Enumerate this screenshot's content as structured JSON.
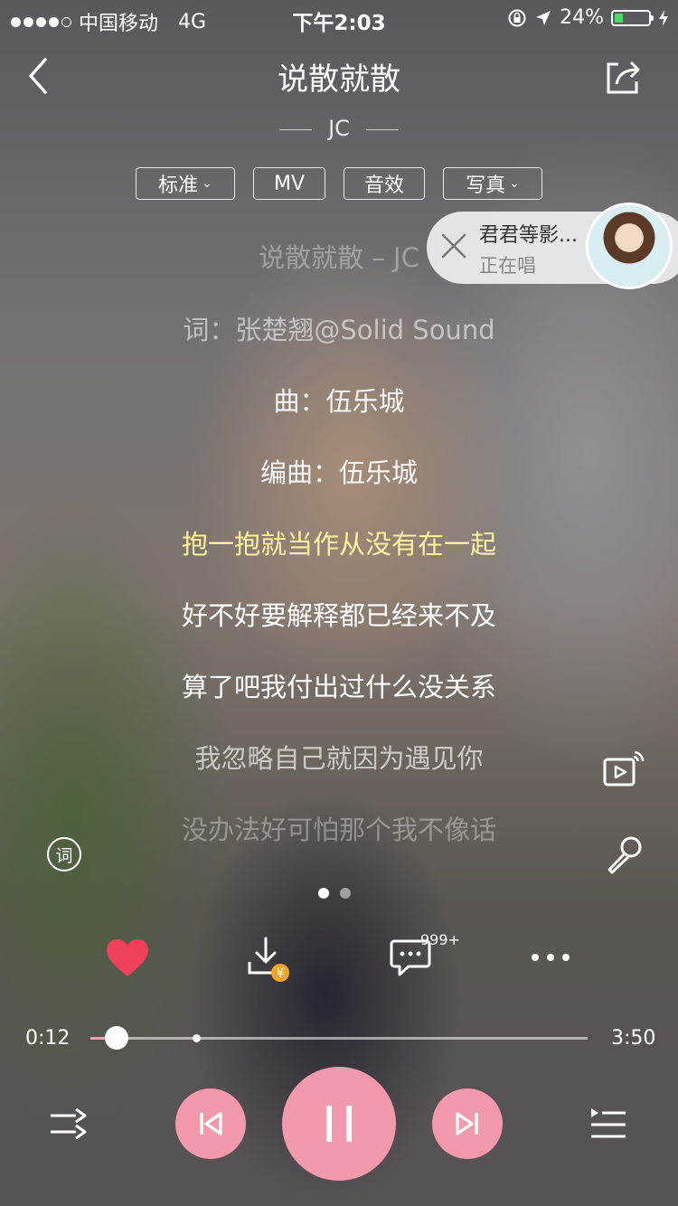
{
  "status": {
    "carrier": "中国移动",
    "network": "4G",
    "time": "下午2:03",
    "battery": "24%",
    "battery_level": 0.24
  },
  "header": {
    "title": "说散就散",
    "artist": "JC"
  },
  "options": [
    {
      "label": "标准",
      "dropdown": true
    },
    {
      "label": "MV",
      "dropdown": false
    },
    {
      "label": "音效",
      "dropdown": false
    },
    {
      "label": "写真",
      "dropdown": true
    }
  ],
  "live_bubble": {
    "name": "君君等影...",
    "status": "正在唱"
  },
  "lyrics": [
    {
      "text": "说散就散 – JC",
      "state": "faded"
    },
    {
      "text": "词：张楚翘@Solid Sound",
      "state": "dim"
    },
    {
      "text": "曲：伍乐城",
      "state": "normal"
    },
    {
      "text": "编曲：伍乐城",
      "state": "normal"
    },
    {
      "text": "抱一抱就当作从没有在一起",
      "state": "active"
    },
    {
      "text": "好不好要解释都已经来不及",
      "state": "normal"
    },
    {
      "text": "算了吧我付出过什么没关系",
      "state": "normal"
    },
    {
      "text": "我忽略自己就因为遇见你",
      "state": "dim"
    },
    {
      "text": "没办法好可怕那个我不像话",
      "state": "faded"
    }
  ],
  "side_icons": {
    "lyrics_icon_label": "词"
  },
  "actions": {
    "comment_count": "999+"
  },
  "player": {
    "elapsed": "0:12",
    "duration": "3:50",
    "progress": 0.052,
    "buffered": 0.205
  },
  "colors": {
    "accent": "#f29aac",
    "active_lyric": "#fff3a0",
    "like": "#f0415a"
  }
}
